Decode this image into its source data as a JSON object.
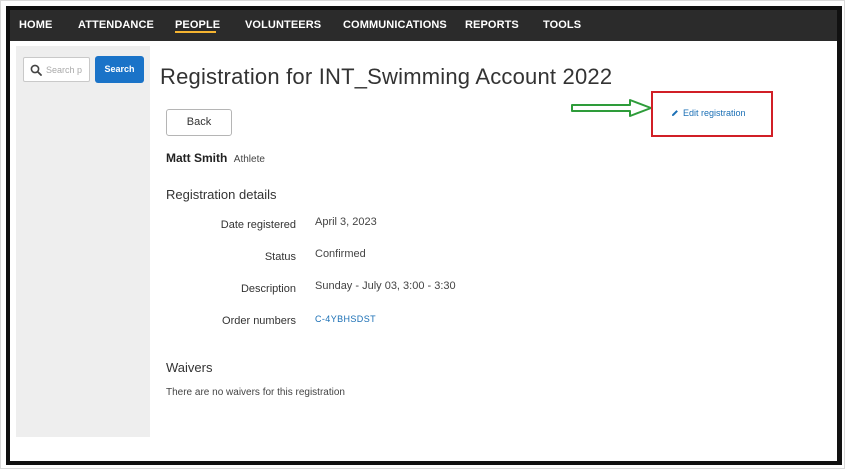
{
  "nav": {
    "items": [
      {
        "label": "HOME"
      },
      {
        "label": "ATTENDANCE"
      },
      {
        "label": "PEOPLE",
        "active": true
      },
      {
        "label": "VOLUNTEERS"
      },
      {
        "label": "COMMUNICATIONS"
      },
      {
        "label": "REPORTS"
      },
      {
        "label": "TOOLS"
      }
    ],
    "active_color": "#f5b431",
    "background": "#2b2b2b"
  },
  "sidebar": {
    "search": {
      "placeholder": "Search p",
      "icon": "search-icon"
    },
    "search_button_label": "Search"
  },
  "page": {
    "title": "Registration for INT_Swimming Account 2022",
    "back_label": "Back",
    "person_name": "Matt Smith",
    "person_role": "Athlete",
    "edit_label": "Edit registration",
    "edit_icon": "pencil-icon",
    "highlight_color": "#d11f26",
    "arrow_color": "#2e9c3a"
  },
  "registration": {
    "heading": "Registration details",
    "rows": [
      {
        "label": "Date registered",
        "value": "April 3, 2023"
      },
      {
        "label": "Status",
        "value": "Confirmed"
      },
      {
        "label": "Description",
        "value": "Sunday - July 03, 3:00 - 3:30"
      },
      {
        "label": "Order numbers",
        "value": "C-4YBHSDST",
        "link": true
      }
    ]
  },
  "waivers": {
    "heading": "Waivers",
    "text": "There are no waivers for this registration"
  }
}
